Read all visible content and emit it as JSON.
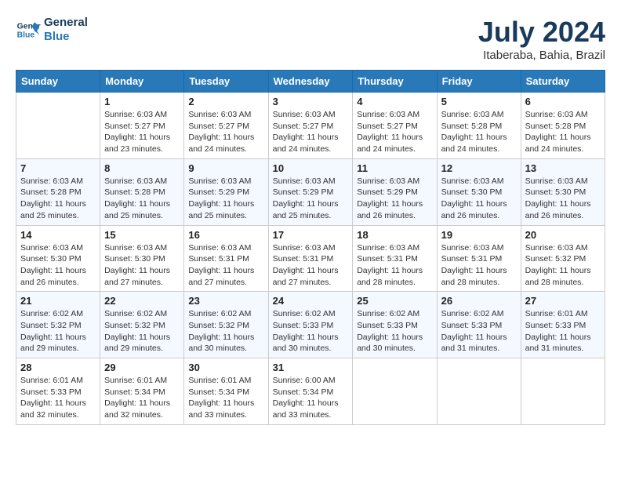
{
  "header": {
    "logo_line1": "General",
    "logo_line2": "Blue",
    "month_year": "July 2024",
    "location": "Itaberaba, Bahia, Brazil"
  },
  "weekdays": [
    "Sunday",
    "Monday",
    "Tuesday",
    "Wednesday",
    "Thursday",
    "Friday",
    "Saturday"
  ],
  "weeks": [
    [
      {
        "day": "",
        "sunrise": "",
        "sunset": "",
        "daylight": ""
      },
      {
        "day": "1",
        "sunrise": "Sunrise: 6:03 AM",
        "sunset": "Sunset: 5:27 PM",
        "daylight": "Daylight: 11 hours and 23 minutes."
      },
      {
        "day": "2",
        "sunrise": "Sunrise: 6:03 AM",
        "sunset": "Sunset: 5:27 PM",
        "daylight": "Daylight: 11 hours and 24 minutes."
      },
      {
        "day": "3",
        "sunrise": "Sunrise: 6:03 AM",
        "sunset": "Sunset: 5:27 PM",
        "daylight": "Daylight: 11 hours and 24 minutes."
      },
      {
        "day": "4",
        "sunrise": "Sunrise: 6:03 AM",
        "sunset": "Sunset: 5:27 PM",
        "daylight": "Daylight: 11 hours and 24 minutes."
      },
      {
        "day": "5",
        "sunrise": "Sunrise: 6:03 AM",
        "sunset": "Sunset: 5:28 PM",
        "daylight": "Daylight: 11 hours and 24 minutes."
      },
      {
        "day": "6",
        "sunrise": "Sunrise: 6:03 AM",
        "sunset": "Sunset: 5:28 PM",
        "daylight": "Daylight: 11 hours and 24 minutes."
      }
    ],
    [
      {
        "day": "7",
        "sunrise": "Sunrise: 6:03 AM",
        "sunset": "Sunset: 5:28 PM",
        "daylight": "Daylight: 11 hours and 25 minutes."
      },
      {
        "day": "8",
        "sunrise": "Sunrise: 6:03 AM",
        "sunset": "Sunset: 5:28 PM",
        "daylight": "Daylight: 11 hours and 25 minutes."
      },
      {
        "day": "9",
        "sunrise": "Sunrise: 6:03 AM",
        "sunset": "Sunset: 5:29 PM",
        "daylight": "Daylight: 11 hours and 25 minutes."
      },
      {
        "day": "10",
        "sunrise": "Sunrise: 6:03 AM",
        "sunset": "Sunset: 5:29 PM",
        "daylight": "Daylight: 11 hours and 25 minutes."
      },
      {
        "day": "11",
        "sunrise": "Sunrise: 6:03 AM",
        "sunset": "Sunset: 5:29 PM",
        "daylight": "Daylight: 11 hours and 26 minutes."
      },
      {
        "day": "12",
        "sunrise": "Sunrise: 6:03 AM",
        "sunset": "Sunset: 5:30 PM",
        "daylight": "Daylight: 11 hours and 26 minutes."
      },
      {
        "day": "13",
        "sunrise": "Sunrise: 6:03 AM",
        "sunset": "Sunset: 5:30 PM",
        "daylight": "Daylight: 11 hours and 26 minutes."
      }
    ],
    [
      {
        "day": "14",
        "sunrise": "Sunrise: 6:03 AM",
        "sunset": "Sunset: 5:30 PM",
        "daylight": "Daylight: 11 hours and 26 minutes."
      },
      {
        "day": "15",
        "sunrise": "Sunrise: 6:03 AM",
        "sunset": "Sunset: 5:30 PM",
        "daylight": "Daylight: 11 hours and 27 minutes."
      },
      {
        "day": "16",
        "sunrise": "Sunrise: 6:03 AM",
        "sunset": "Sunset: 5:31 PM",
        "daylight": "Daylight: 11 hours and 27 minutes."
      },
      {
        "day": "17",
        "sunrise": "Sunrise: 6:03 AM",
        "sunset": "Sunset: 5:31 PM",
        "daylight": "Daylight: 11 hours and 27 minutes."
      },
      {
        "day": "18",
        "sunrise": "Sunrise: 6:03 AM",
        "sunset": "Sunset: 5:31 PM",
        "daylight": "Daylight: 11 hours and 28 minutes."
      },
      {
        "day": "19",
        "sunrise": "Sunrise: 6:03 AM",
        "sunset": "Sunset: 5:31 PM",
        "daylight": "Daylight: 11 hours and 28 minutes."
      },
      {
        "day": "20",
        "sunrise": "Sunrise: 6:03 AM",
        "sunset": "Sunset: 5:32 PM",
        "daylight": "Daylight: 11 hours and 28 minutes."
      }
    ],
    [
      {
        "day": "21",
        "sunrise": "Sunrise: 6:02 AM",
        "sunset": "Sunset: 5:32 PM",
        "daylight": "Daylight: 11 hours and 29 minutes."
      },
      {
        "day": "22",
        "sunrise": "Sunrise: 6:02 AM",
        "sunset": "Sunset: 5:32 PM",
        "daylight": "Daylight: 11 hours and 29 minutes."
      },
      {
        "day": "23",
        "sunrise": "Sunrise: 6:02 AM",
        "sunset": "Sunset: 5:32 PM",
        "daylight": "Daylight: 11 hours and 30 minutes."
      },
      {
        "day": "24",
        "sunrise": "Sunrise: 6:02 AM",
        "sunset": "Sunset: 5:33 PM",
        "daylight": "Daylight: 11 hours and 30 minutes."
      },
      {
        "day": "25",
        "sunrise": "Sunrise: 6:02 AM",
        "sunset": "Sunset: 5:33 PM",
        "daylight": "Daylight: 11 hours and 30 minutes."
      },
      {
        "day": "26",
        "sunrise": "Sunrise: 6:02 AM",
        "sunset": "Sunset: 5:33 PM",
        "daylight": "Daylight: 11 hours and 31 minutes."
      },
      {
        "day": "27",
        "sunrise": "Sunrise: 6:01 AM",
        "sunset": "Sunset: 5:33 PM",
        "daylight": "Daylight: 11 hours and 31 minutes."
      }
    ],
    [
      {
        "day": "28",
        "sunrise": "Sunrise: 6:01 AM",
        "sunset": "Sunset: 5:33 PM",
        "daylight": "Daylight: 11 hours and 32 minutes."
      },
      {
        "day": "29",
        "sunrise": "Sunrise: 6:01 AM",
        "sunset": "Sunset: 5:34 PM",
        "daylight": "Daylight: 11 hours and 32 minutes."
      },
      {
        "day": "30",
        "sunrise": "Sunrise: 6:01 AM",
        "sunset": "Sunset: 5:34 PM",
        "daylight": "Daylight: 11 hours and 33 minutes."
      },
      {
        "day": "31",
        "sunrise": "Sunrise: 6:00 AM",
        "sunset": "Sunset: 5:34 PM",
        "daylight": "Daylight: 11 hours and 33 minutes."
      },
      {
        "day": "",
        "sunrise": "",
        "sunset": "",
        "daylight": ""
      },
      {
        "day": "",
        "sunrise": "",
        "sunset": "",
        "daylight": ""
      },
      {
        "day": "",
        "sunrise": "",
        "sunset": "",
        "daylight": ""
      }
    ]
  ]
}
